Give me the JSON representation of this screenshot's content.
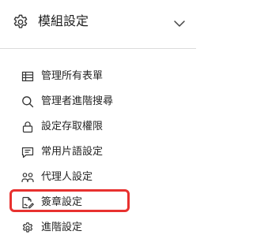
{
  "header": {
    "title": "模組設定",
    "icon": "gear-icon",
    "toggle_icon": "chevron-down-icon"
  },
  "menu": {
    "items": [
      {
        "label": "管理所有表單",
        "icon": "table-icon"
      },
      {
        "label": "管理者進階搜尋",
        "icon": "search-icon"
      },
      {
        "label": "設定存取權限",
        "icon": "lock-icon"
      },
      {
        "label": "常用片語設定",
        "icon": "message-icon"
      },
      {
        "label": "代理人設定",
        "icon": "users-icon"
      },
      {
        "label": "簽章設定",
        "icon": "signature-icon"
      },
      {
        "label": "進階設定",
        "icon": "gear-icon"
      }
    ]
  },
  "colors": {
    "highlight": "#e8312f",
    "text": "#262626",
    "divider": "#dcdcdc"
  }
}
